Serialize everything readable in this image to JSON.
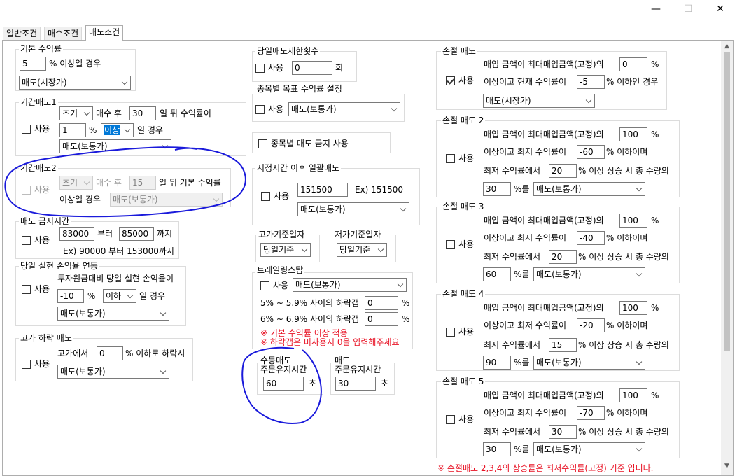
{
  "window": {
    "minimize": "—",
    "maximize": "☐",
    "close": "✕"
  },
  "tabs": [
    "일반조건",
    "매수조건",
    "매도조건"
  ],
  "basic_profit": {
    "title": "기본 수익률",
    "value": "5",
    "suffix": "% 이상일 경우",
    "order_type": "매도(시장가)"
  },
  "period1": {
    "title": "기간매도1",
    "use": "사용",
    "period": "초기",
    "after_buy": "매수 후",
    "days": "30",
    "days_suffix": "일 뒤 수익률이",
    "rate": "1",
    "rate_suffix": "%",
    "cond": "이상",
    "cond_suffix": "일 경우",
    "order_type": "매도(보통가)"
  },
  "period2": {
    "title": "기간매도2",
    "use": "사용",
    "period": "초기",
    "after_buy": "매수 후",
    "days": "15",
    "days_suffix": "일 뒤 기본 수익률",
    "line2": "이상일 경우",
    "order_type": "매도(보통가)"
  },
  "sell_ban": {
    "title": "매도 금지시간",
    "use": "사용",
    "from": "83000",
    "from_suffix": "부터",
    "to": "85000",
    "to_suffix": "까지",
    "example": "Ex) 90000 부터 153000까지"
  },
  "daily_loss": {
    "title": "당일 실현 손익율 연동",
    "use": "사용",
    "desc": "투자원금대비 당일 실현 손익율이",
    "rate": "-10",
    "rate_suffix": "%",
    "cond": "이하",
    "cond_suffix": "일 경우",
    "order_type": "매도(보통가)"
  },
  "high_drop": {
    "title": "고가 하락 매도",
    "use": "사용",
    "prefix": "고가에서",
    "rate": "0",
    "suffix": "% 이하로 하락시",
    "order_type": "매도(보통가)"
  },
  "daily_limit": {
    "title": "당일매도제한횟수",
    "use": "사용",
    "count": "0",
    "suffix": "회"
  },
  "target_profit": {
    "title": "종목별 목표 수익률 설정",
    "use": "사용",
    "order_type": "매도(보통가)"
  },
  "ban_per_stock": {
    "label": "종목별 매도 금지 사용"
  },
  "after_time": {
    "title": "지정시간 이후 일괄매도",
    "use": "사용",
    "time": "151500",
    "example": "Ex) 151500",
    "order_type": "매도(보통가)"
  },
  "high_base": {
    "title": "고가기준일자",
    "value": "당일기준"
  },
  "low_base": {
    "title": "저가기준일자",
    "value": "당일기준"
  },
  "trailing": {
    "title": "트레일링스탑",
    "use": "사용",
    "order_type": "매도(보통가)",
    "row1_label": "5% ~ 5.9% 사이의 하락갭",
    "row1_value": "0",
    "row2_label": "6% ~ 6.9% 사이의 하락갭",
    "row2_value": "0",
    "unit": "%",
    "note1": "※ 기본 수익률 이상 적용",
    "note2": "※ 하락갭은 미사용시 0을 입력해주세요"
  },
  "manual_sell": {
    "title1": "수동매도",
    "title2": "주문유지시간",
    "value": "60",
    "unit": "초"
  },
  "sell_hold": {
    "title1": "매도",
    "title2": "주문유지시간",
    "value": "30",
    "unit": "초"
  },
  "stop_loss": {
    "title": "손절 매도",
    "use": "사용",
    "line1": "매입 금액이 최대매입금액(고정)의",
    "rate": "0",
    "rate_suffix": "%",
    "line2": "이상이고 현재 수익률이",
    "cur": "-5",
    "cur_suffix": "% 이하인 경우",
    "order_type": "매도(시장가)"
  },
  "stop_losses": [
    {
      "title": "손절 매도 2",
      "use": "사용",
      "line1": "매입 금액이 최대매입금액(고정)의",
      "buy_rate": "100",
      "pct": "%",
      "line2": "이상이고 최저 수익률이",
      "low_rate": "-60",
      "low_suffix": "% 이하이며",
      "line3": "최저 수익률에서",
      "rise": "20",
      "rise_suffix": "% 이상 상승 시 총 수량의",
      "qty": "30",
      "qty_suffix": "%를",
      "order_type": "매도(보통가)"
    },
    {
      "title": "손절 매도 3",
      "use": "사용",
      "line1": "매입 금액이 최대매입금액(고정)의",
      "buy_rate": "100",
      "pct": "%",
      "line2": "이상이고 최저 수익률이",
      "low_rate": "-40",
      "low_suffix": "% 이하이며",
      "line3": "최저 수익률에서",
      "rise": "20",
      "rise_suffix": "% 이상 상승 시 총 수량의",
      "qty": "60",
      "qty_suffix": "%를",
      "order_type": "매도(보통가)"
    },
    {
      "title": "손절 매도 4",
      "use": "사용",
      "line1": "매입 금액이 최대매입금액(고정)의",
      "buy_rate": "100",
      "pct": "%",
      "line2": "이상이고 최저 수익률이",
      "low_rate": "-20",
      "low_suffix": "% 이하이며",
      "line3": "최저 수익률에서",
      "rise": "15",
      "rise_suffix": "% 이상 상승 시 총 수량의",
      "qty": "90",
      "qty_suffix": "%를",
      "order_type": "매도(보통가)"
    },
    {
      "title": "손절 매도 5",
      "use": "사용",
      "line1": "매입 금액이 최대매입금액(고정)의",
      "buy_rate": "100",
      "pct": "%",
      "line2": "이상이고 최저 수익률이",
      "low_rate": "-70",
      "low_suffix": "% 이하이며",
      "line3": "최저 수익률에서",
      "rise": "30",
      "rise_suffix": "% 이상 상승 시 총 수량의",
      "qty": "30",
      "qty_suffix": "%를",
      "order_type": "매도(보통가)"
    }
  ],
  "footer_note": "※ 손절매도 2,3,4의 상승률은 최저수익률(고정) 기준 입니다.",
  "colors": {
    "accent": "#0078d7",
    "note_red": "#e81123",
    "annotation": "#1a1adb"
  }
}
